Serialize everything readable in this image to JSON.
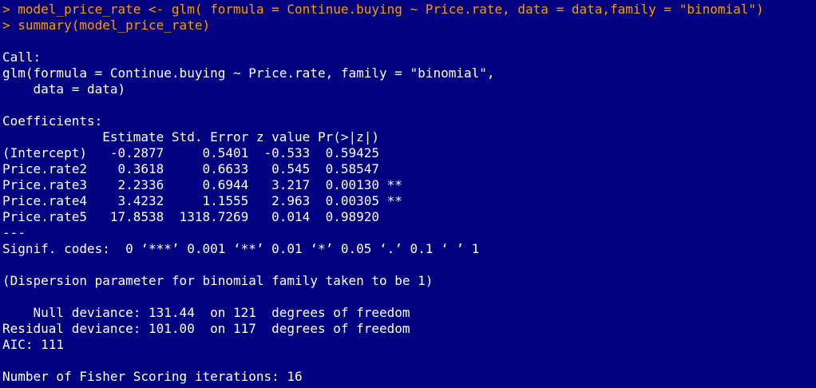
{
  "console": {
    "colors": {
      "background": "#000080",
      "command": "#ff9900",
      "output": "#ffffff"
    },
    "lines": [
      {
        "type": "cmd",
        "text": "> model_price_rate <- glm( formula = Continue.buying ~ Price.rate, data = data,family = \"binomial\")"
      },
      {
        "type": "cmd",
        "text": "> summary(model_price_rate)"
      },
      {
        "type": "out",
        "text": ""
      },
      {
        "type": "out",
        "text": "Call:"
      },
      {
        "type": "out",
        "text": "glm(formula = Continue.buying ~ Price.rate, family = \"binomial\","
      },
      {
        "type": "out",
        "text": "    data = data)"
      },
      {
        "type": "out",
        "text": ""
      },
      {
        "type": "out",
        "text": "Coefficients:"
      },
      {
        "type": "out",
        "text": "             Estimate Std. Error z value Pr(>|z|)   "
      },
      {
        "type": "out",
        "text": "(Intercept)   -0.2877     0.5401  -0.533  0.59425   "
      },
      {
        "type": "out",
        "text": "Price.rate2    0.3618     0.6633   0.545  0.58547   "
      },
      {
        "type": "out",
        "text": "Price.rate3    2.2336     0.6944   3.217  0.00130 **"
      },
      {
        "type": "out",
        "text": "Price.rate4    3.4232     1.1555   2.963  0.00305 **"
      },
      {
        "type": "out",
        "text": "Price.rate5   17.8538  1318.7269   0.014  0.98920   "
      },
      {
        "type": "out",
        "text": "---"
      },
      {
        "type": "out",
        "text": "Signif. codes:  0 ‘***’ 0.001 ‘**’ 0.01 ‘*’ 0.05 ‘.’ 0.1 ‘ ’ 1"
      },
      {
        "type": "out",
        "text": ""
      },
      {
        "type": "out",
        "text": "(Dispersion parameter for binomial family taken to be 1)"
      },
      {
        "type": "out",
        "text": ""
      },
      {
        "type": "out",
        "text": "    Null deviance: 131.44  on 121  degrees of freedom"
      },
      {
        "type": "out",
        "text": "Residual deviance: 101.00  on 117  degrees of freedom"
      },
      {
        "type": "out",
        "text": "AIC: 111"
      },
      {
        "type": "out",
        "text": ""
      },
      {
        "type": "out",
        "text": "Number of Fisher Scoring iterations: 16"
      }
    ]
  }
}
